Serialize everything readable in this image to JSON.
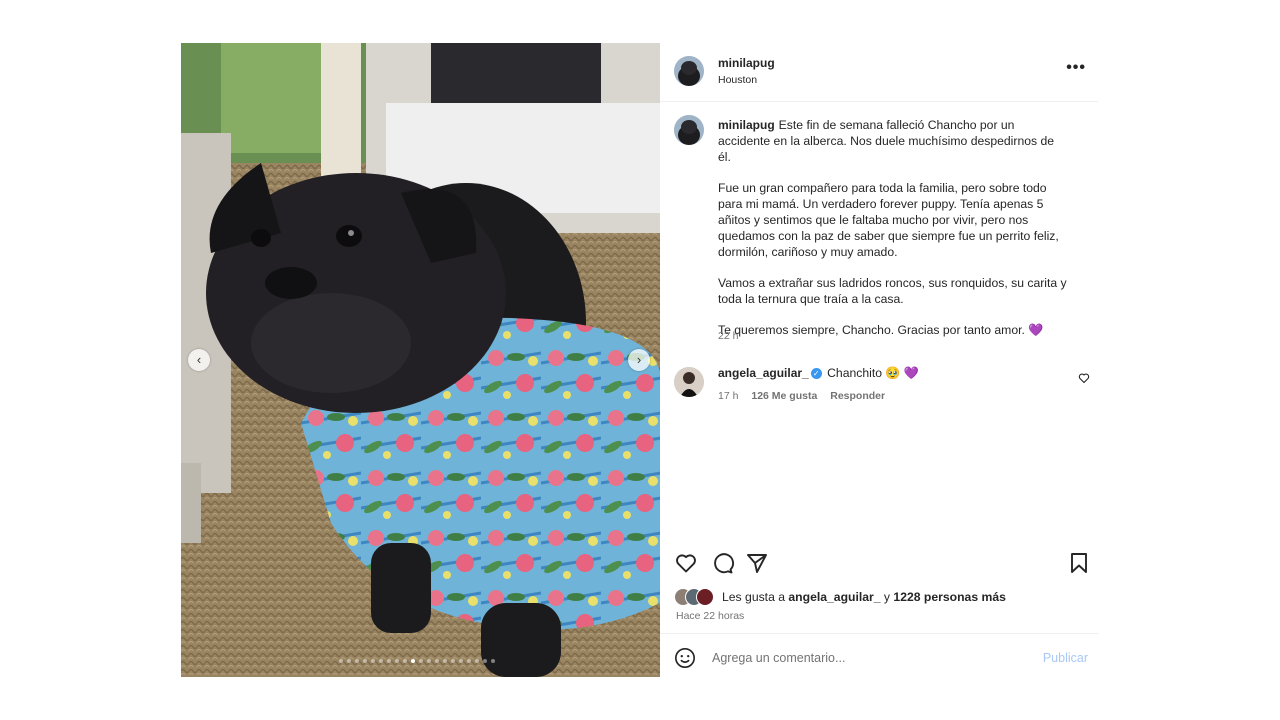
{
  "post": {
    "username": "minilapug",
    "location": "Houston",
    "more_label": "•••"
  },
  "media": {
    "description_icon": "photo",
    "prev_label": "‹",
    "next_label": "›",
    "dot_count": 20,
    "active_dot": 9
  },
  "caption": {
    "username": "minilapug",
    "paragraphs": [
      "Este fin de semana falleció Chancho por un accidente en la alberca. Nos duele muchísimo despedirnos de él.",
      "Fue un gran compañero para toda la familia, pero sobre todo para mi mamá. Un verdadero forever puppy. Tenía apenas 5 añitos y sentimos que le faltaba mucho por vivir, pero nos quedamos con la paz de saber que siempre fue un perrito feliz, dormilón, cariñoso y muy amado.",
      "Vamos a extrañar sus ladridos roncos, sus ronquidos, su carita y toda la ternura que traía a la casa.",
      "Te queremos siempre, Chancho. Gracias por tanto amor. 💜"
    ],
    "time": "22 h"
  },
  "comment": {
    "username": "angela_aguilar_",
    "verified_mark": "✓",
    "text": "Chanchito 🥹 💜",
    "time": "17 h",
    "likes": "126 Me gusta",
    "reply": "Responder"
  },
  "likes": {
    "prefix": "Les gusta a ",
    "user": "angela_aguilar_",
    "joiner": " y ",
    "others": "1228 personas más"
  },
  "posted_ago": "Hace 22 horas",
  "add_comment": {
    "placeholder": "Agrega un comentario...",
    "publish_label": "Publicar"
  },
  "colors": {
    "text": "#262626",
    "muted": "#737373",
    "link_disabled": "#a8c8f8",
    "verified": "#3897f0",
    "divider": "#efefef"
  }
}
